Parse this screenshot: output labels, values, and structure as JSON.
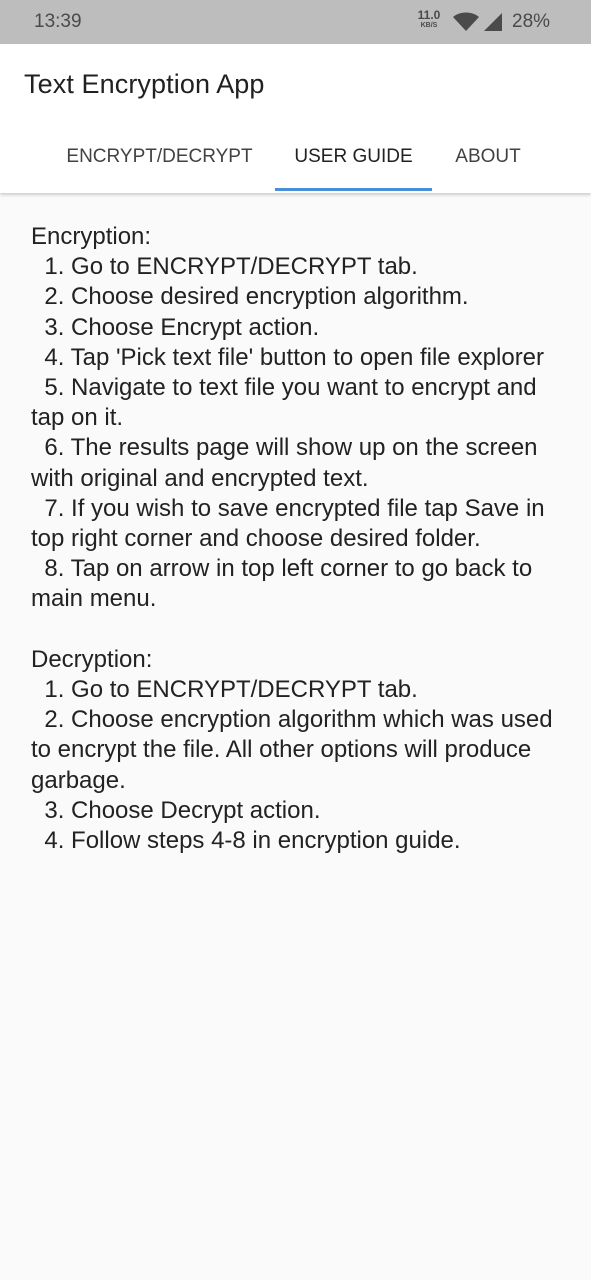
{
  "status_bar": {
    "time": "13:39",
    "net_speed_value": "11.0",
    "net_speed_unit": "KB/S",
    "battery": "28%"
  },
  "app": {
    "title": "Text Encryption App"
  },
  "tabs": [
    {
      "label": "ENCRYPT/DECRYPT",
      "selected": false
    },
    {
      "label": "USER GUIDE",
      "selected": true
    },
    {
      "label": "ABOUT",
      "selected": false
    }
  ],
  "colors": {
    "status_bar": "#bdbdbd",
    "tab_indicator": "#4a90d9",
    "background": "#fafafa"
  },
  "guide": {
    "encryption": {
      "title": "Encryption:",
      "steps": [
        "  1. Go to ENCRYPT/DECRYPT tab.",
        "  2. Choose desired encryption algorithm.",
        "  3. Choose Encrypt action.",
        "  4. Tap 'Pick text file' button to open file explorer",
        "  5. Navigate to text file you want to encrypt and tap on it.",
        "  6. The results page will show up on the screen with original and encrypted text.",
        "  7. If you wish to save encrypted file tap Save in top right corner and choose desired folder.",
        "  8. Tap on arrow in top left corner to go back to main menu."
      ]
    },
    "decryption": {
      "title": "Decryption:",
      "steps": [
        "  1. Go to ENCRYPT/DECRYPT tab.",
        "  2. Choose encryption algorithm which was used to encrypt the file. All other options will produce garbage.",
        "  3. Choose Decrypt action.",
        "  4. Follow steps 4-8 in encryption guide."
      ]
    }
  }
}
